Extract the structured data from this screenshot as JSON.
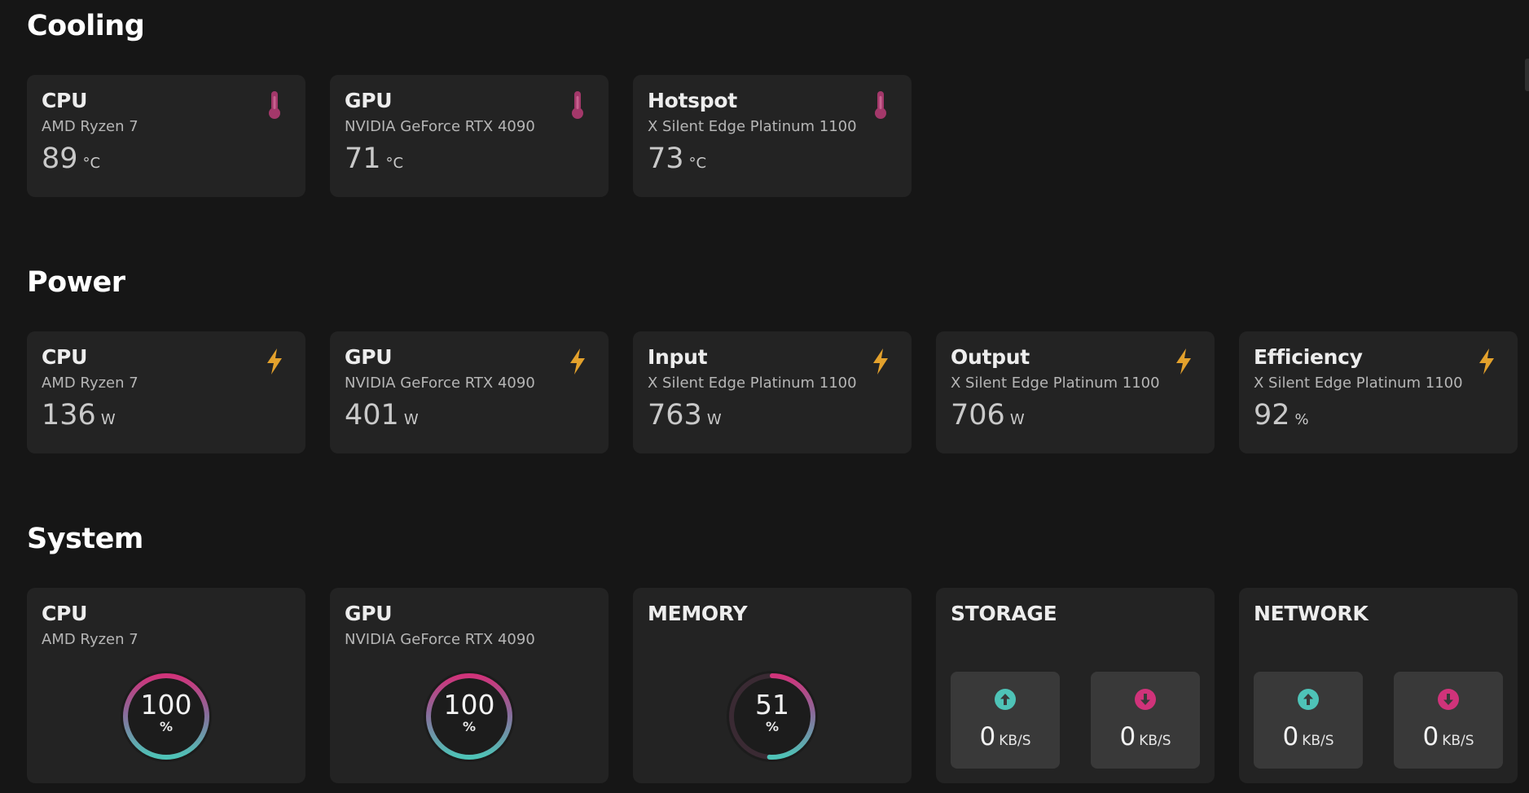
{
  "colors": {
    "background": "#161616",
    "card": "#232323",
    "thermometer": "#a3386a",
    "bolt": "#e3a12c",
    "upload": "#4ec3b7",
    "download": "#d0337a",
    "gauge_track": "#3a2a33"
  },
  "cooling": {
    "title": "Cooling",
    "cards": [
      {
        "title": "CPU",
        "subtitle": "AMD Ryzen 7",
        "value": "89",
        "unit": "°C",
        "icon": "thermometer-icon"
      },
      {
        "title": "GPU",
        "subtitle": "NVIDIA GeForce RTX 4090",
        "value": "71",
        "unit": "°C",
        "icon": "thermometer-icon"
      },
      {
        "title": "Hotspot",
        "subtitle": "X Silent Edge Platinum 1100",
        "value": "73",
        "unit": "°C",
        "icon": "thermometer-icon"
      }
    ]
  },
  "power": {
    "title": "Power",
    "cards": [
      {
        "title": "CPU",
        "subtitle": "AMD Ryzen 7",
        "value": "136",
        "unit": "W",
        "icon": "lightning-icon"
      },
      {
        "title": "GPU",
        "subtitle": "NVIDIA GeForce RTX 4090",
        "value": "401",
        "unit": "W",
        "icon": "lightning-icon"
      },
      {
        "title": "Input",
        "subtitle": "X Silent Edge Platinum 1100",
        "value": "763",
        "unit": "W",
        "icon": "lightning-icon"
      },
      {
        "title": "Output",
        "subtitle": "X Silent Edge Platinum 1100",
        "value": "706",
        "unit": "W",
        "icon": "lightning-icon"
      },
      {
        "title": "Efficiency",
        "subtitle": "X Silent Edge Platinum 1100",
        "value": "92",
        "unit": "%",
        "icon": "lightning-icon"
      }
    ]
  },
  "system": {
    "title": "System",
    "cpu": {
      "title": "CPU",
      "subtitle": "AMD Ryzen 7",
      "value": "100",
      "unit": "%",
      "percent": 100
    },
    "gpu": {
      "title": "GPU",
      "subtitle": "NVIDIA GeForce RTX 4090",
      "value": "100",
      "unit": "%",
      "percent": 100
    },
    "memory": {
      "title": "MEMORY",
      "value": "51",
      "unit": "%",
      "percent": 51
    },
    "storage": {
      "title": "STORAGE",
      "upload": {
        "value": "0",
        "unit": "KB/S",
        "icon": "upload-arrow-icon"
      },
      "download": {
        "value": "0",
        "unit": "KB/S",
        "icon": "download-arrow-icon"
      }
    },
    "network": {
      "title": "NETWORK",
      "upload": {
        "value": "0",
        "unit": "KB/S",
        "icon": "upload-arrow-icon"
      },
      "download": {
        "value": "0",
        "unit": "KB/S",
        "icon": "download-arrow-icon"
      }
    }
  }
}
